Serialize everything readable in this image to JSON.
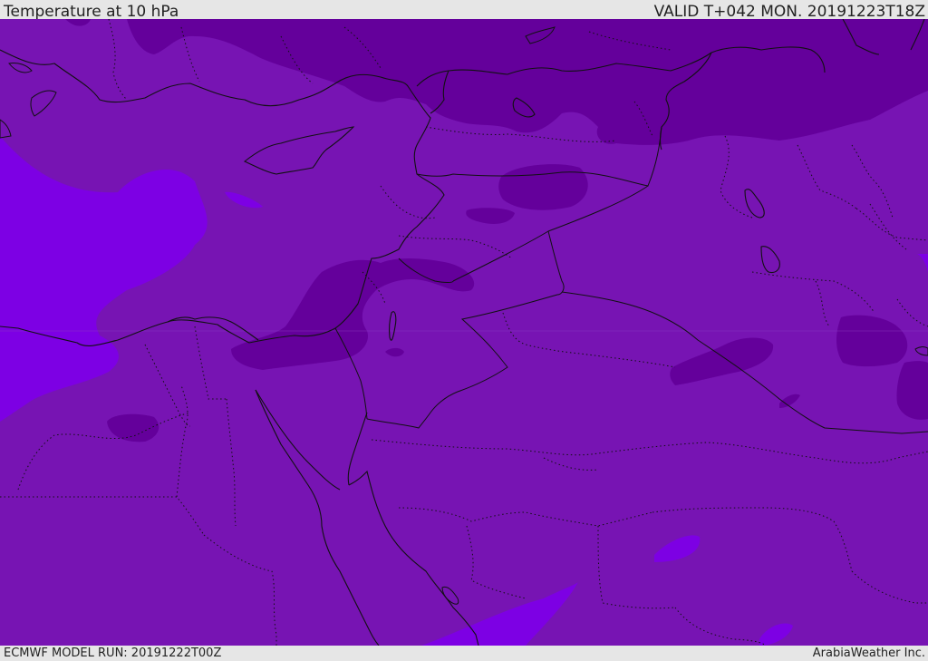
{
  "header": {
    "title": "Temperature at 10 hPa",
    "valid": "VALID T+042 MON. 20191223T18Z"
  },
  "footer": {
    "model_run": "ECMWF MODEL RUN: 20191222T00Z",
    "credit": "ArabiaWeather Inc."
  },
  "map": {
    "colors": {
      "background": "#7714b3",
      "cold_zone": "#64009b",
      "warm_zone": "#7d00e4",
      "coastline": "#111111",
      "borders": "#111111"
    }
  }
}
